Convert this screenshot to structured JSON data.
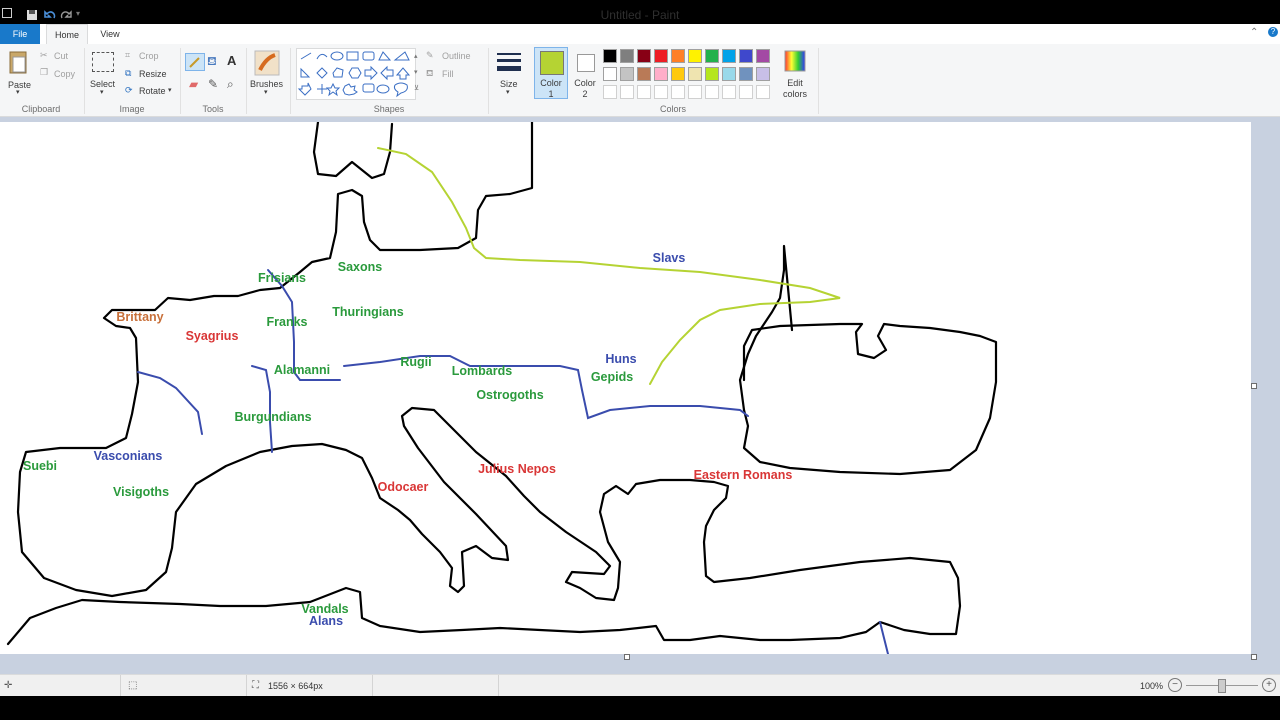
{
  "window": {
    "title": "Untitled - Paint"
  },
  "tabs": {
    "file": "File",
    "home": "Home",
    "view": "View"
  },
  "ribbon": {
    "clipboard": {
      "label": "Clipboard",
      "paste": "Paste",
      "cut": "Cut",
      "copy": "Copy"
    },
    "image": {
      "label": "Image",
      "select": "Select",
      "crop": "Crop",
      "resize": "Resize",
      "rotate": "Rotate"
    },
    "tools": {
      "label": "Tools"
    },
    "brushes": {
      "label": "Brushes"
    },
    "shapes": {
      "label": "Shapes",
      "outline": "Outline",
      "fill": "Fill"
    },
    "size": {
      "label": "Size"
    },
    "colors": {
      "label": "Colors",
      "color1": "Color\n1",
      "color1_value": "#b5d333",
      "color2": "Color\n2",
      "color2_value": "#ffffff",
      "edit": "Edit\ncolors",
      "palette_row1": [
        "#000000",
        "#7f7f7f",
        "#880015",
        "#ed1c24",
        "#ff7f27",
        "#fff200",
        "#22b14c",
        "#00a2e8",
        "#3f48cc",
        "#a349a4"
      ],
      "palette_row2": [
        "#ffffff",
        "#c3c3c3",
        "#b97a57",
        "#ffaec9",
        "#ffc90e",
        "#efe4b0",
        "#b5e61d",
        "#99d9ea",
        "#7092be",
        "#c8bfe7"
      ]
    }
  },
  "map": {
    "labels": [
      {
        "text": "Slavs",
        "color": "#3a4cad"
      },
      {
        "text": "Frisians",
        "color": "#2a9a3c"
      },
      {
        "text": "Saxons",
        "color": "#2a9a3c"
      },
      {
        "text": "Brittany",
        "color": "#c8703a"
      },
      {
        "text": "Syagrius",
        "color": "#d93636"
      },
      {
        "text": "Franks",
        "color": "#2a9a3c"
      },
      {
        "text": "Thuringians",
        "color": "#2a9a3c"
      },
      {
        "text": "Huns",
        "color": "#3a4cad"
      },
      {
        "text": "Gepids",
        "color": "#2a9a3c"
      },
      {
        "text": "Rugii",
        "color": "#2a9a3c"
      },
      {
        "text": "Alamanni",
        "color": "#2a9a3c"
      },
      {
        "text": "Lombards",
        "color": "#2a9a3c"
      },
      {
        "text": "Ostrogoths",
        "color": "#2a9a3c"
      },
      {
        "text": "Burgundians",
        "color": "#2a9a3c"
      },
      {
        "text": "Vasconians",
        "color": "#3a4cad"
      },
      {
        "text": "Suebi",
        "color": "#2a9a3c"
      },
      {
        "text": "Julius Nepos",
        "color": "#d93636"
      },
      {
        "text": "Eastern Romans",
        "color": "#d93636"
      },
      {
        "text": "Odocaer",
        "color": "#d93636"
      },
      {
        "text": "Visigoths",
        "color": "#2a9a3c"
      },
      {
        "text": "Vandals",
        "color": "#2a9a3c"
      },
      {
        "text": "Alans",
        "color": "#3a4cad"
      }
    ]
  },
  "statusbar": {
    "dimensions": "1556 × 664px",
    "zoom": "100%"
  }
}
